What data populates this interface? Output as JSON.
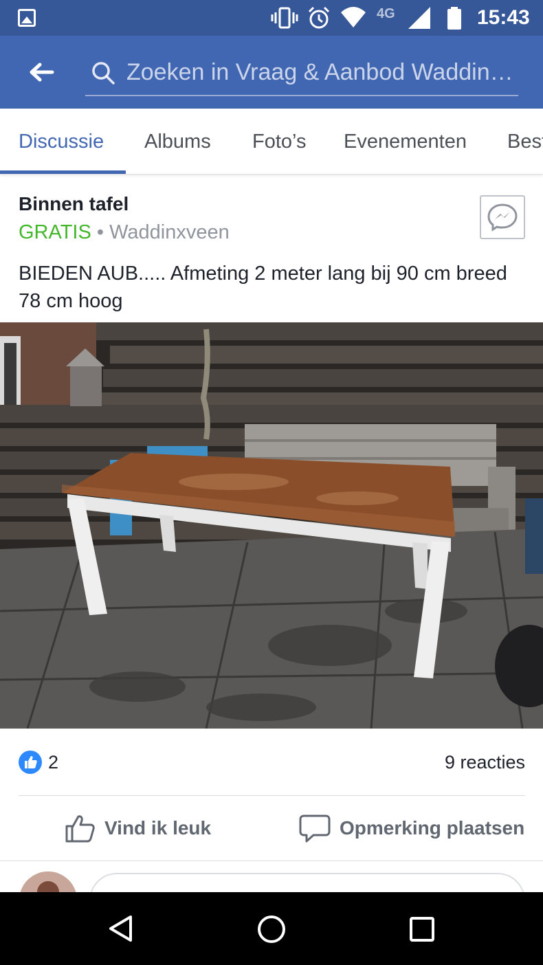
{
  "status_bar": {
    "time": "15:43",
    "network": "4G",
    "icons": [
      "gallery-icon",
      "vibrate-icon",
      "alarm-icon",
      "wifi-icon",
      "signal-icon",
      "battery-icon"
    ]
  },
  "search": {
    "placeholder": "Zoeken in Vraag & Aanbod Waddin…"
  },
  "tabs": [
    {
      "label": "Discussie",
      "active": true
    },
    {
      "label": "Albums",
      "active": false
    },
    {
      "label": "Foto’s",
      "active": false
    },
    {
      "label": "Evenementen",
      "active": false
    },
    {
      "label": "Best",
      "active": false
    }
  ],
  "post": {
    "title": "Binnen tafel",
    "price": "GRATIS",
    "separator": "•",
    "location": "Waddinxveen",
    "text": "BIEDEN AUB..... Afmeting 2 meter lang bij 90 cm breed 78 cm hoog"
  },
  "reactions": {
    "like_count": "2",
    "comments_label": "9 reacties"
  },
  "actions": {
    "like_label": "Vind ik leuk",
    "comment_label": "Opmerking plaatsen"
  },
  "colors": {
    "status_bar": "#365899",
    "header": "#4267b2",
    "price": "#42b72a",
    "like_badge": "#2e89ff"
  }
}
